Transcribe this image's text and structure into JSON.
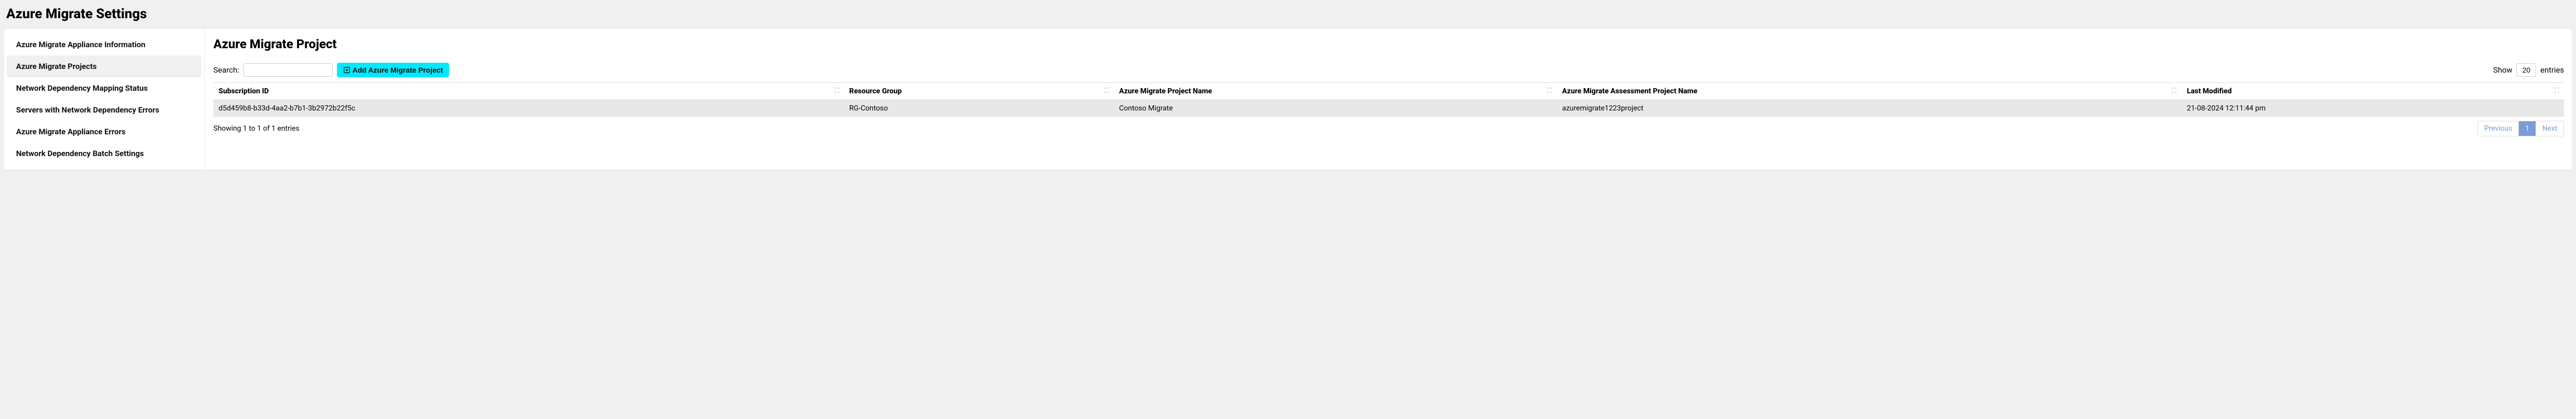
{
  "page": {
    "title": "Azure Migrate Settings"
  },
  "sidebar": {
    "items": [
      {
        "label": "Azure Migrate Appliance Information"
      },
      {
        "label": "Azure Migrate Projects"
      },
      {
        "label": "Network Dependency Mapping Status"
      },
      {
        "label": "Servers with Network Dependency Errors"
      },
      {
        "label": "Azure Migrate Appliance Errors"
      },
      {
        "label": "Network Dependency Batch Settings"
      }
    ],
    "activeIndex": 1
  },
  "content": {
    "title": "Azure Migrate Project"
  },
  "toolbar": {
    "searchLabel": "Search:",
    "searchValue": "",
    "addButton": "Add Azure Migrate Project",
    "showLabel": "Show",
    "entriesValue": "20",
    "entriesLabel": "entries"
  },
  "table": {
    "headers": [
      "Subscription ID",
      "Resource Group",
      "Azure Migrate Project Name",
      "Azure Migrate Assessment Project Name",
      "Last Modified"
    ],
    "rows": [
      {
        "cells": [
          "d5d459b8-b33d-4aa2-b7b1-3b2972b22f5c",
          "RG-Contoso",
          "Contoso Migrate",
          "azuremigrate1223project",
          "21-08-2024 12:11:44 pm"
        ]
      }
    ]
  },
  "footer": {
    "info": "Showing 1 to 1 of 1 entries",
    "prev": "Previous",
    "page": "1",
    "next": "Next"
  }
}
